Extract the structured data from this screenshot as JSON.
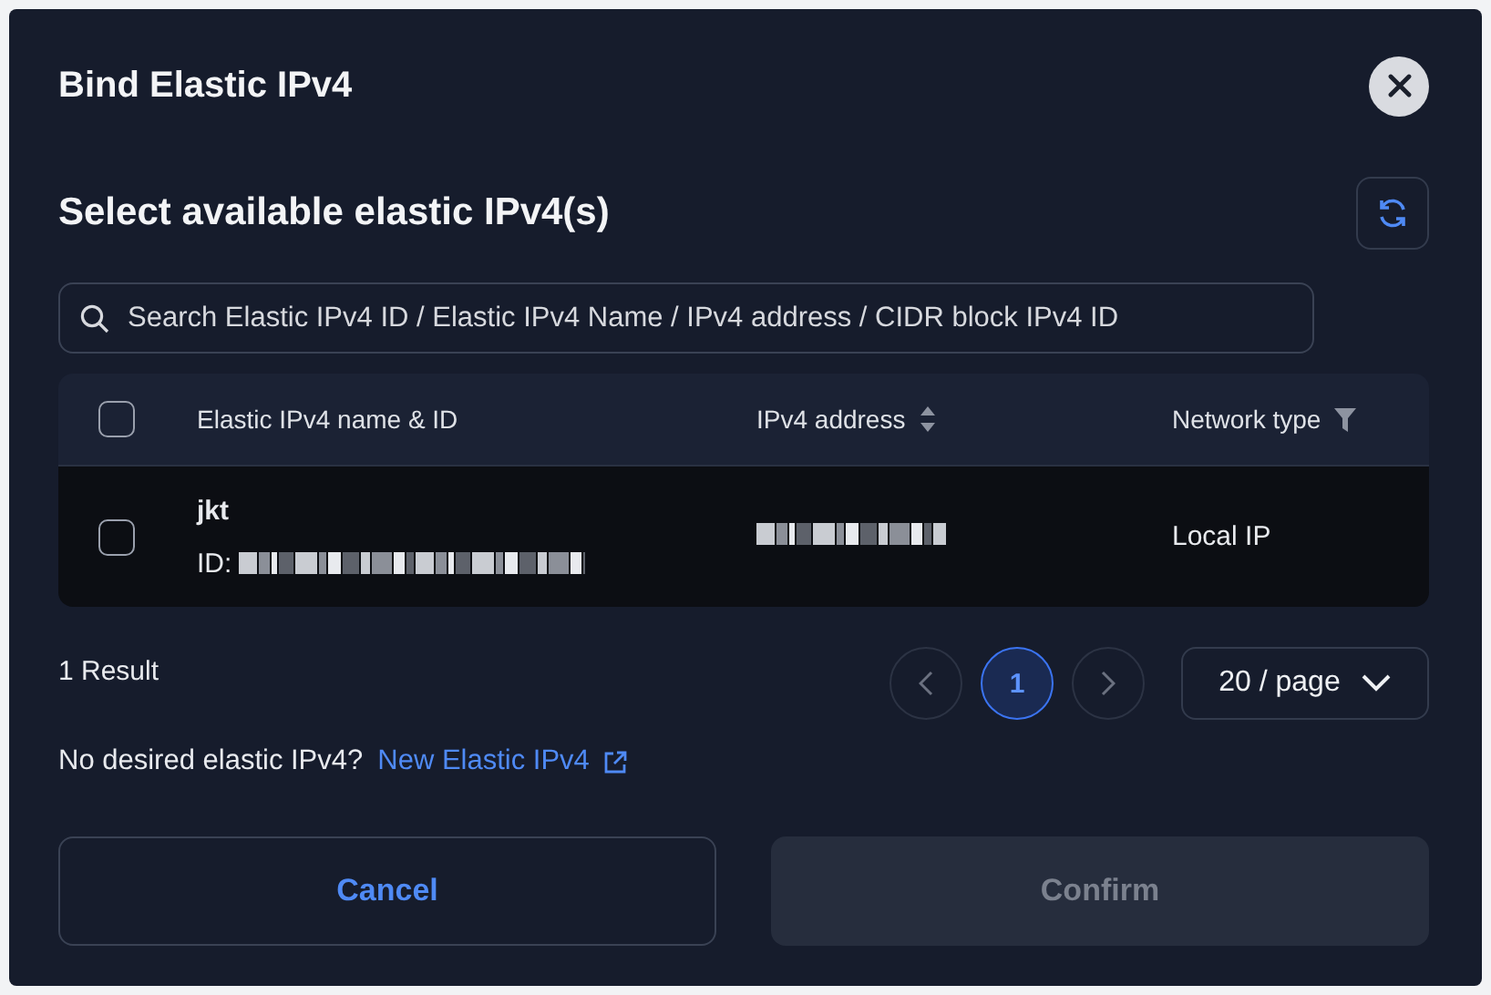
{
  "dialog": {
    "title": "Bind Elastic IPv4"
  },
  "section": {
    "title": "Select available elastic IPv4(s)"
  },
  "search": {
    "placeholder": "Search Elastic IPv4 ID / Elastic IPv4 Name / IPv4 address / CIDR block IPv4 ID"
  },
  "table": {
    "all_selected": false,
    "columns": [
      {
        "label": "Elastic IPv4 name & ID",
        "kind": "plain"
      },
      {
        "label": "IPv4 address",
        "kind": "sort"
      },
      {
        "label": "Network type",
        "kind": "filter"
      }
    ],
    "rows": [
      {
        "name": "jkt",
        "id_label": "ID:",
        "network_type": "Local IP",
        "selected": false
      }
    ]
  },
  "footer": {
    "result_count": "1 Result",
    "pages": [
      {
        "label": "1",
        "selected": true
      }
    ],
    "page_size": "20 / page"
  },
  "hint": {
    "text": "No desired elastic IPv4?",
    "link": "New Elastic IPv4"
  },
  "buttons": [
    {
      "label": "Cancel",
      "kind": "secondary",
      "disabled": false
    },
    {
      "label": "Confirm",
      "kind": "primary",
      "disabled": true
    }
  ]
}
